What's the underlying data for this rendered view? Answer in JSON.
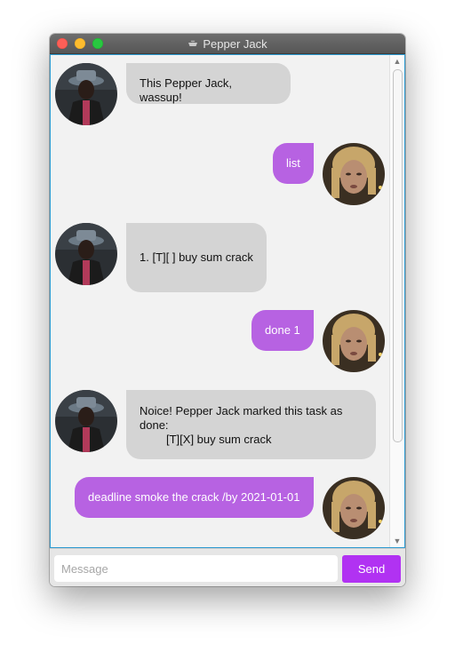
{
  "window": {
    "title": "Pepper Jack",
    "title_icon": "cup-icon"
  },
  "colors": {
    "bot_bubble": "#d4d4d4",
    "user_bubble": "#b762e2",
    "send_button": "#b132f2",
    "dialog_border": "#2c9ad1"
  },
  "messages": [
    {
      "sender": "bot",
      "text": "This Pepper Jack, wassup!"
    },
    {
      "sender": "user",
      "text": "list"
    },
    {
      "sender": "bot",
      "text": "1. [T][ ] buy sum crack"
    },
    {
      "sender": "user",
      "text": "done 1"
    },
    {
      "sender": "bot",
      "line1": "Noice! Pepper Jack marked this task as",
      "line2": "done:",
      "line3": "[T][X] buy sum crack"
    },
    {
      "sender": "user",
      "text": "deadline smoke the crack /by 2021-01-01"
    }
  ],
  "input": {
    "value": "",
    "placeholder": "Message"
  },
  "send_button": {
    "label": "Send"
  }
}
